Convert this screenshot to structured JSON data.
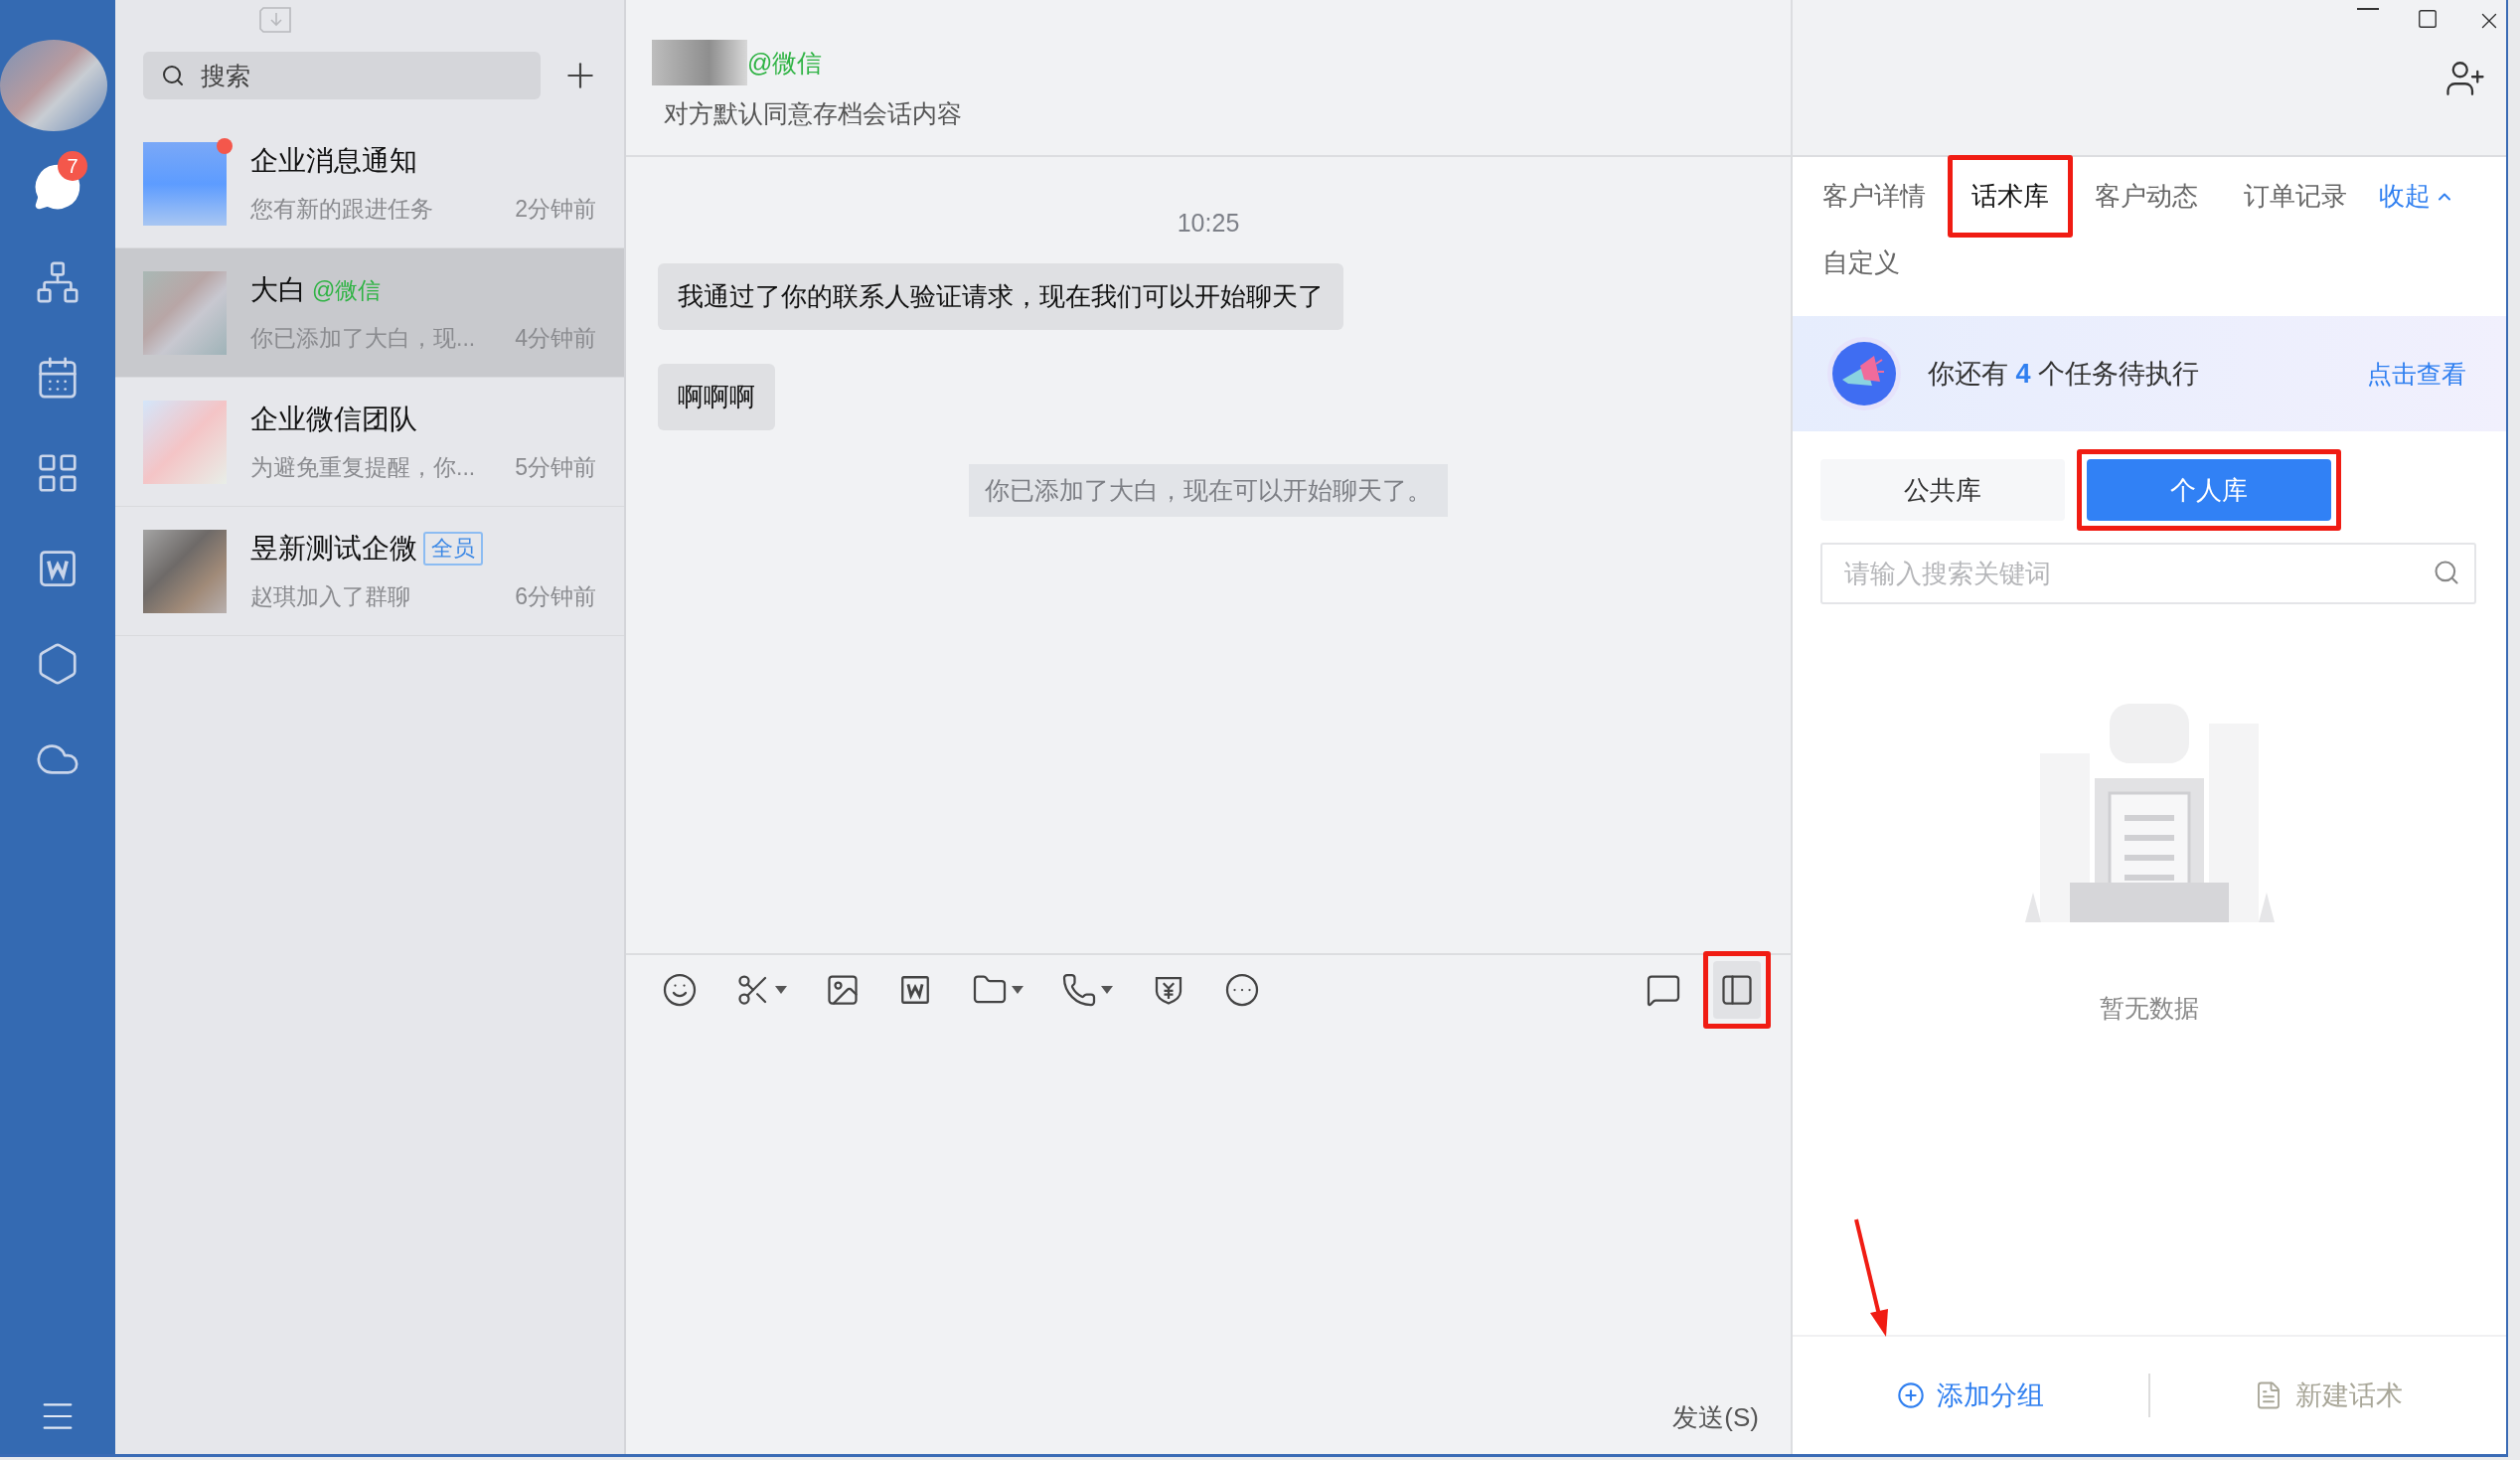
{
  "sidebar": {
    "nav": [
      {
        "kind": "chat",
        "selected": true,
        "badge": "7"
      },
      {
        "kind": "org",
        "selected": false
      },
      {
        "kind": "calendar",
        "selected": false
      },
      {
        "kind": "apps",
        "selected": false
      },
      {
        "kind": "doc",
        "selected": false
      },
      {
        "kind": "cube",
        "selected": false
      },
      {
        "kind": "cloud",
        "selected": false
      }
    ]
  },
  "chat_list": {
    "search": {
      "placeholder": "搜索"
    },
    "conversations": [
      {
        "name": "企业消息通知",
        "preview": "您有新的跟进任务",
        "time": "2分钟前",
        "selected": false,
        "unread": true
      },
      {
        "name": "大白",
        "tag": {
          "text": "@微信",
          "kind": "external"
        },
        "preview": "你已添加了大白，现...",
        "time": "4分钟前",
        "selected": true,
        "unread": false
      },
      {
        "name": "企业微信团队",
        "preview": "为避免重复提醒，你...",
        "time": "5分钟前",
        "selected": false,
        "unread": false
      },
      {
        "name": "昱新测试企微",
        "tag": {
          "text": "全员",
          "kind": "badge"
        },
        "preview": "赵琪加入了群聊",
        "time": "6分钟前",
        "selected": false,
        "unread": false
      }
    ]
  },
  "chat": {
    "header": {
      "name_tag": "@微信",
      "subtitle": "对方默认同意存档会话内容"
    },
    "messages": [
      {
        "kind": "time",
        "text": "10:25"
      },
      {
        "kind": "bubble",
        "text": "我通过了你的联系人验证请求，现在我们可以开始聊天了"
      },
      {
        "kind": "bubble",
        "text": "啊啊啊"
      },
      {
        "kind": "system",
        "text": "你已添加了大白，现在可以开始聊天了。"
      }
    ],
    "toolbar": [
      {
        "kind": "emoji",
        "dropdown": false,
        "selected": false,
        "highlighted": false
      },
      {
        "kind": "scissors",
        "dropdown": true,
        "selected": false,
        "highlighted": false
      },
      {
        "kind": "image",
        "dropdown": false,
        "selected": false,
        "highlighted": false
      },
      {
        "kind": "doc",
        "dropdown": false,
        "selected": false,
        "highlighted": false
      },
      {
        "kind": "folder",
        "dropdown": true,
        "selected": false,
        "highlighted": false
      },
      {
        "kind": "phone",
        "dropdown": true,
        "selected": false,
        "highlighted": false
      },
      {
        "kind": "money",
        "dropdown": false,
        "selected": false,
        "highlighted": false
      },
      {
        "kind": "more",
        "dropdown": false,
        "selected": false,
        "highlighted": false
      },
      {
        "kind": "history",
        "dropdown": false,
        "selected": false,
        "highlighted": false
      },
      {
        "kind": "panel",
        "dropdown": false,
        "selected": true,
        "highlighted": true
      }
    ],
    "send_button": "发送(S)"
  },
  "right_panel": {
    "tabs": [
      {
        "label": "客户详情",
        "selected": false,
        "highlighted": false
      },
      {
        "label": "话术库",
        "selected": true,
        "highlighted": true
      },
      {
        "label": "客户动态",
        "selected": false,
        "highlighted": false
      },
      {
        "label": "订单记录",
        "selected": false,
        "highlighted": false
      },
      {
        "label": "自定义",
        "selected": false,
        "highlighted": false
      }
    ],
    "collapse": "收起",
    "task_banner": {
      "text": "你还有 **4** 个任务待执行",
      "link": "点击查看"
    },
    "library_tabs": [
      {
        "label": "公共库",
        "selected": false,
        "highlighted": false
      },
      {
        "label": "个人库",
        "selected": true,
        "highlighted": true
      }
    ],
    "search": {
      "placeholder": "请输入搜索关键词"
    },
    "empty_text": "暂无数据",
    "footer": {
      "annotation_arrow": true,
      "actions": [
        {
          "kind": "add",
          "label": "添加分组",
          "disabled": false
        },
        {
          "kind": "new",
          "label": "新建话术",
          "disabled": true
        }
      ]
    }
  }
}
